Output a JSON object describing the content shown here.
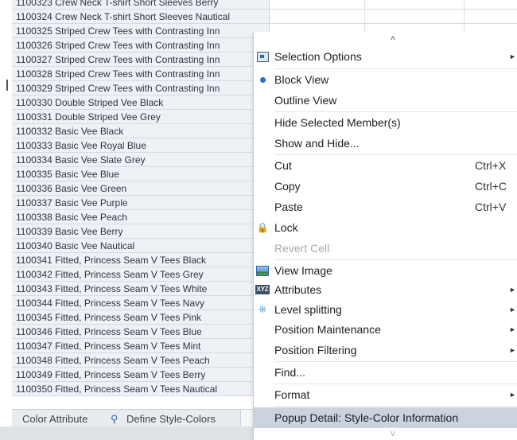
{
  "grid": {
    "rows": [
      "1100323 Crew Neck T-shirt Short Sleeves Berry",
      "1100324 Crew Neck T-shirt Short Sleeves Nautical",
      "1100325 Striped Crew Tees with Contrasting Inn",
      "1100326 Striped Crew Tees with Contrasting Inn",
      "1100327 Striped Crew Tees with Contrasting Inn",
      "1100328 Striped Crew Tees with Contrasting Inn",
      "1100329 Striped Crew Tees with Contrasting Inn",
      "1100330 Double Striped Vee Black",
      "1100331 Double Striped Vee Grey",
      "1100332 Basic Vee Black",
      "1100333 Basic Vee Royal Blue",
      "1100334 Basic Vee Slate Grey",
      "1100335 Basic Vee Blue",
      "1100336 Basic Vee Green",
      "1100337 Basic Vee Purple",
      "1100338 Basic Vee Peach",
      "1100339 Basic Vee Berry",
      "1100340 Basic Vee Nautical",
      "1100341 Fitted, Princess Seam V Tees Black",
      "1100342 Fitted, Princess Seam V Tees Grey",
      "1100343 Fitted, Princess Seam V Tees White",
      "1100344 Fitted, Princess Seam V Tees Navy",
      "1100345 Fitted, Princess Seam V Tees Pink",
      "1100346 Fitted, Princess Seam V Tees Blue",
      "1100347 Fitted, Princess Seam V Tees Mint",
      "1100348 Fitted, Princess Seam V Tees Peach",
      "1100349 Fitted, Princess Seam V Tees Berry",
      "1100350 Fitted, Princess Seam V Tees Nautical"
    ]
  },
  "tabs": {
    "color_attribute": "Color Attribute",
    "define_style_colors": "Define Style-Colors"
  },
  "menu": {
    "scroll_up": "^",
    "scroll_down": "v",
    "items": [
      {
        "label": "Selection Options",
        "icon": "selection-options-icon",
        "submenu": true
      },
      {
        "label": "Block View",
        "icon": "radio-selected-icon"
      },
      {
        "label": "Outline View"
      },
      {
        "label": "Hide Selected Member(s)"
      },
      {
        "label": "Show and Hide..."
      },
      {
        "label": "Cut",
        "shortcut": "Ctrl+X"
      },
      {
        "label": "Copy",
        "shortcut": "Ctrl+C"
      },
      {
        "label": "Paste",
        "shortcut": "Ctrl+V"
      },
      {
        "label": "Lock",
        "icon": "lock-icon"
      },
      {
        "label": "Revert Cell",
        "disabled": true
      },
      {
        "label": "View Image",
        "icon": "image-icon"
      },
      {
        "label": "Attributes",
        "icon": "xyz-icon",
        "submenu": true
      },
      {
        "label": "Level splitting",
        "icon": "level-splitting-icon",
        "submenu": true
      },
      {
        "label": "Position Maintenance",
        "submenu": true
      },
      {
        "label": "Position Filtering",
        "submenu": true
      },
      {
        "label": "Find..."
      },
      {
        "label": "Format",
        "submenu": true
      },
      {
        "label": "Popup Detail: Style-Color Information",
        "highlighted": true
      }
    ],
    "xyz_text": "XYZ",
    "submenu_arrow": "►",
    "lock_glyph": "🔒",
    "split_glyph": "⁜"
  },
  "colors": {
    "highlight": "#cad3de",
    "grid_name_bg": "#eef2f6",
    "radio_dot": "#2b6fd0"
  }
}
